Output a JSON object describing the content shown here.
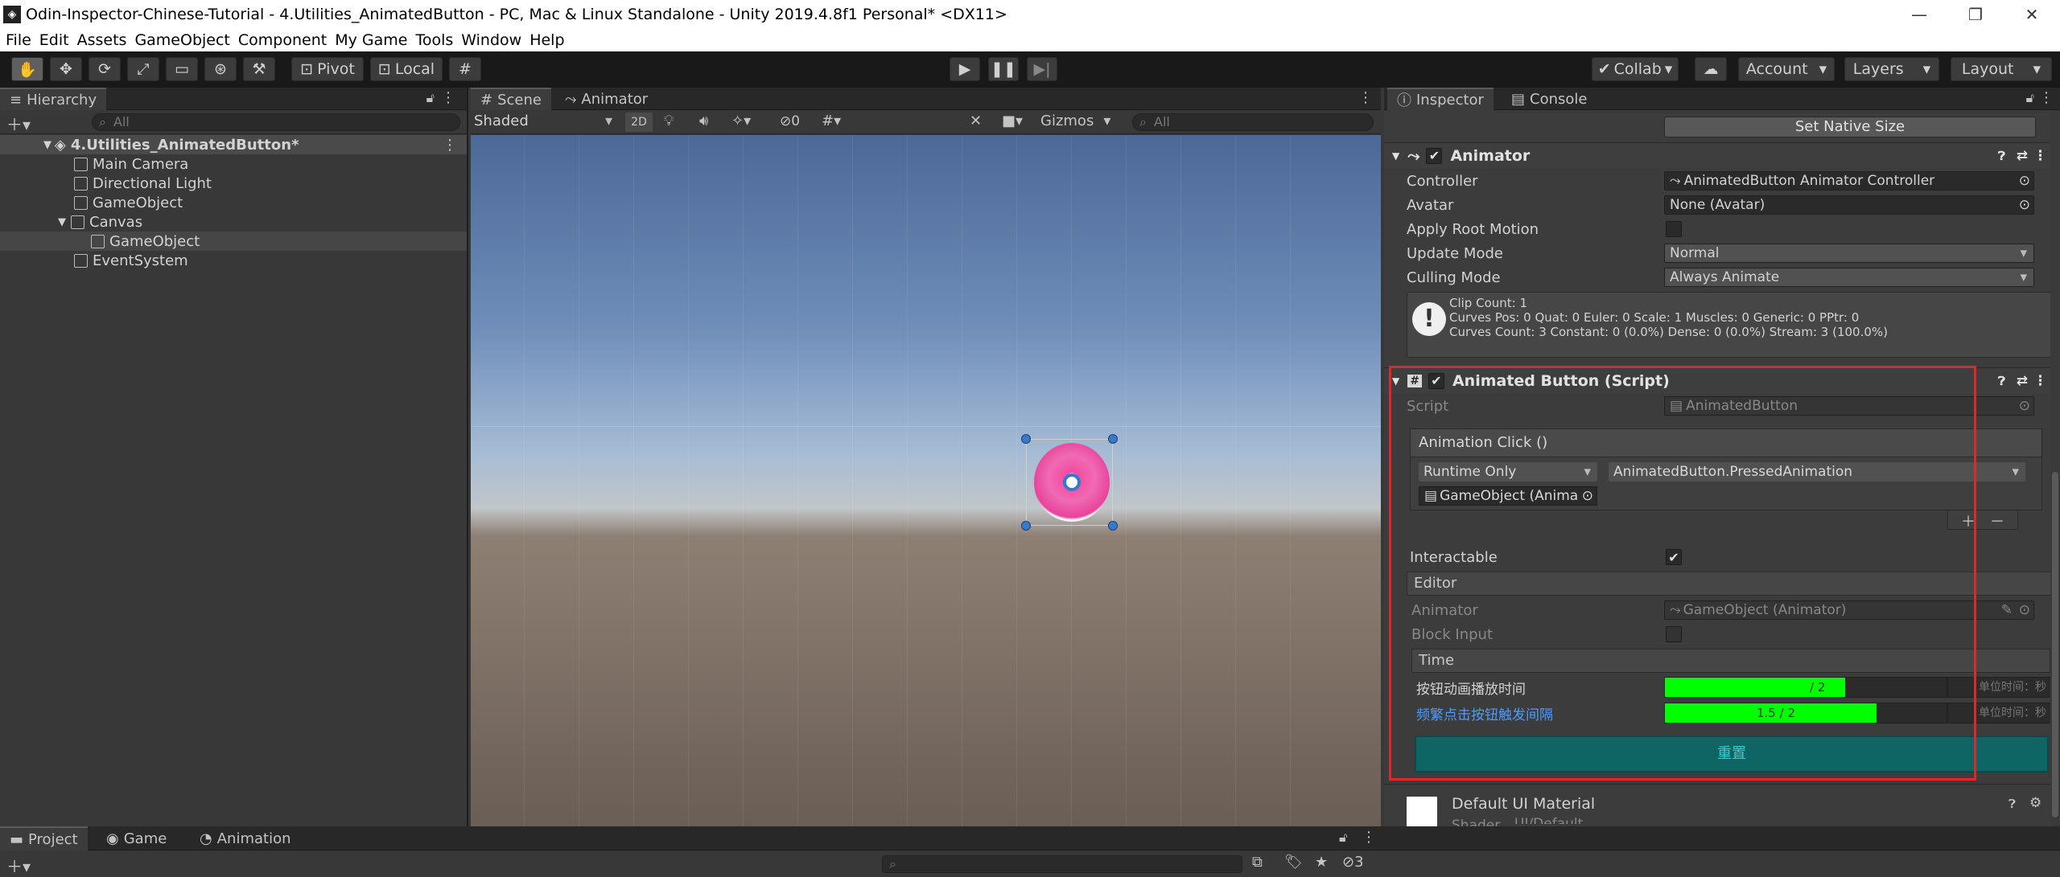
{
  "window": {
    "title": "Odin-Inspector-Chinese-Tutorial - 4.Utilities_AnimatedButton - PC, Mac & Linux Standalone - Unity 2019.4.8f1 Personal* <DX11>",
    "minimize": "—",
    "maximize": "❐",
    "close": "✕"
  },
  "menu": [
    "File",
    "Edit",
    "Assets",
    "GameObject",
    "Component",
    "My Game",
    "Tools",
    "Window",
    "Help"
  ],
  "toolbar": {
    "pivot": "Pivot",
    "local": "Local",
    "collab": "Collab",
    "account": "Account",
    "layers": "Layers",
    "layout": "Layout"
  },
  "hierarchy": {
    "tab": "Hierarchy",
    "search_placeholder": "All",
    "scene": "4.Utilities_AnimatedButton*",
    "items": [
      "Main Camera",
      "Directional Light",
      "GameObject",
      "Canvas",
      "GameObject",
      "EventSystem"
    ]
  },
  "scene_view": {
    "tabs": [
      "Scene",
      "Animator"
    ],
    "shading": "Shaded",
    "mode2d": "2D",
    "hidden_count": "0",
    "gizmos": "Gizmos",
    "search_placeholder": "All"
  },
  "inspector": {
    "tabs": [
      "Inspector",
      "Console"
    ],
    "set_native_size": "Set Native Size",
    "animator": {
      "title": "Animator",
      "rows": [
        {
          "label": "Controller",
          "value": "AnimatedButton Animator Controller"
        },
        {
          "label": "Avatar",
          "value": "None (Avatar)"
        },
        {
          "label": "Apply Root Motion",
          "value": ""
        },
        {
          "label": "Update Mode",
          "value": "Normal"
        },
        {
          "label": "Culling Mode",
          "value": "Always Animate"
        }
      ],
      "info": [
        "Clip Count: 1",
        "Curves Pos: 0 Quat: 0 Euler: 0 Scale: 1 Muscles: 0 Generic: 0 PPtr: 0",
        "Curves Count: 3 Constant: 0 (0.0%) Dense: 0 (0.0%) Stream: 3 (100.0%)"
      ]
    },
    "script_component": {
      "title": "Animated Button (Script)",
      "script_label": "Script",
      "script_value": "AnimatedButton",
      "event_header": "Animation Click ()",
      "runtime": "Runtime Only",
      "method": "AnimatedButton.PressedAnimation",
      "target": "GameObject (Anima",
      "interactable_label": "Interactable",
      "editor_group": "Editor",
      "animator_label": "Animator",
      "animator_value": "GameObject (Animator)",
      "block_input_label": "Block Input",
      "time_group": "Time",
      "slider1_label": "按钮动画播放时间",
      "slider1_text": "/ 2",
      "slider1_fraction": 0.64,
      "slider1_unit": "单位时间：秒",
      "slider2_label": "频繁点击按钮触发间隔",
      "slider2_text": "1.5 / 2",
      "slider2_fraction": 0.75,
      "slider2_unit": "单位时间：秒",
      "reset_button": "重置"
    },
    "material": {
      "title": "Default UI Material",
      "shader_label": "Shader",
      "shader_value": "UI/Default"
    }
  },
  "bottom": {
    "tabs": [
      "Project",
      "Game",
      "Animation"
    ],
    "hidden_count": "3"
  },
  "colors": {
    "highlight_box": "#e0262b",
    "slider_fill": "#00ff00",
    "reset_button": "#0f6464",
    "reset_text": "#2fd0d0",
    "link_text": "#4d9bff"
  }
}
